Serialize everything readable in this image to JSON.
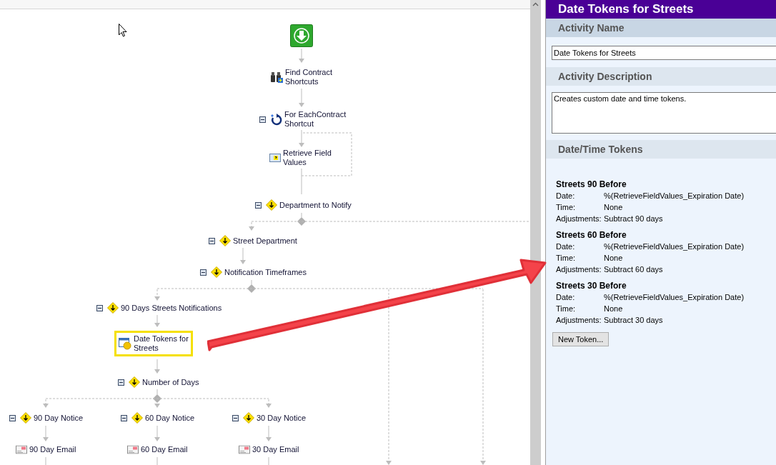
{
  "canvas": {
    "nodes": [
      {
        "kind": "start",
        "selected": false
      },
      {
        "kind": "search",
        "label": "Find Contract\nShortcuts",
        "selected": false
      },
      {
        "kind": "loop",
        "label": "For EachContract\nShortcut",
        "expanded": true,
        "selected": false
      },
      {
        "kind": "form",
        "label": "Retrieve Field\nValues",
        "selected": false
      },
      {
        "kind": "condition",
        "label": "Department to Notify",
        "expanded": true,
        "selected": false
      },
      {
        "kind": "condition",
        "label": "Street Department",
        "expanded": true,
        "selected": false
      },
      {
        "kind": "condition",
        "label": "Notification Timeframes",
        "expanded": true,
        "selected": false
      },
      {
        "kind": "condition",
        "label": "90 Days Streets Notifications",
        "expanded": true,
        "selected": false
      },
      {
        "kind": "token",
        "label": "Date Tokens for\nStreets",
        "selected": true
      },
      {
        "kind": "condition",
        "label": "Number of Days",
        "expanded": true,
        "selected": false
      },
      {
        "kind": "condition",
        "label": "90 Day Notice",
        "expanded": true,
        "selected": false
      },
      {
        "kind": "condition",
        "label": "60 Day Notice",
        "expanded": true,
        "selected": false
      },
      {
        "kind": "condition",
        "label": "30 Day Notice",
        "expanded": true,
        "selected": false
      },
      {
        "kind": "email",
        "label": "90 Day Email",
        "selected": false
      },
      {
        "kind": "email",
        "label": "60 Day Email",
        "selected": false
      },
      {
        "kind": "email",
        "label": "30 Day Email",
        "selected": false
      }
    ]
  },
  "panel": {
    "title": "Date Tokens for Streets",
    "sections": [
      {
        "kind": "field",
        "heading": "Activity Name",
        "value": "Date Tokens for Streets"
      },
      {
        "kind": "textarea",
        "heading": "Activity Description",
        "value": "Creates custom date and time tokens."
      },
      {
        "kind": "tokens",
        "heading": "Date/Time Tokens",
        "tokens": [
          {
            "title": "Streets 90 Before",
            "fields": [
              {
                "label": "Date:",
                "value": "%(RetrieveFieldValues_Expiration Date)"
              },
              {
                "label": "Time:",
                "value": "None"
              },
              {
                "label": "Adjustments:",
                "value": "Subtract 90 days"
              }
            ]
          },
          {
            "title": "Streets 60 Before",
            "fields": [
              {
                "label": "Date:",
                "value": "%(RetrieveFieldValues_Expiration Date)"
              },
              {
                "label": "Time:",
                "value": "None"
              },
              {
                "label": "Adjustments:",
                "value": "Subtract 60 days"
              }
            ]
          },
          {
            "title": "Streets 30 Before",
            "fields": [
              {
                "label": "Date:",
                "value": "%(RetrieveFieldValues_Expiration Date)"
              },
              {
                "label": "Time:",
                "value": "None"
              },
              {
                "label": "Adjustments:",
                "value": "Subtract 30 days"
              }
            ]
          }
        ],
        "button": "New Token..."
      }
    ]
  }
}
